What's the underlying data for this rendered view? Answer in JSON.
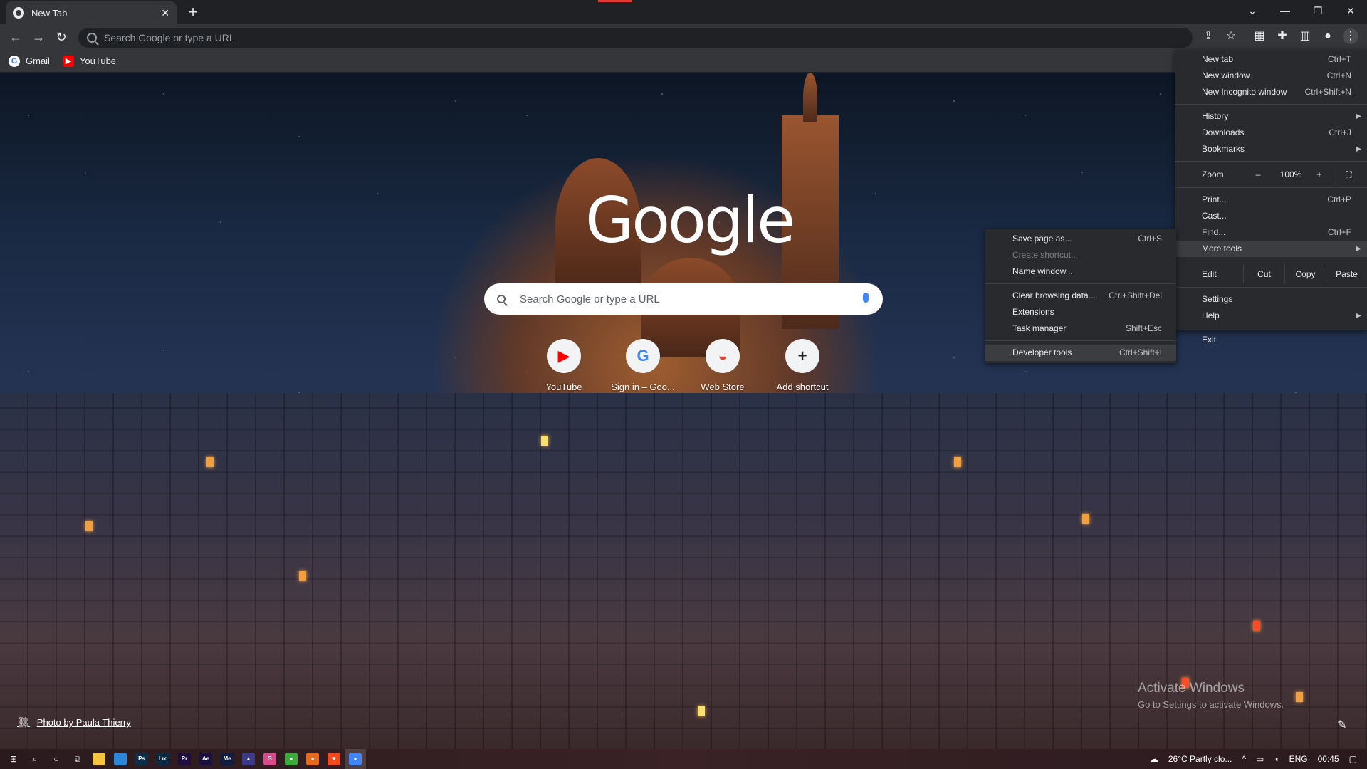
{
  "tab": {
    "title": "New Tab",
    "close": "✕",
    "new_tab": "+"
  },
  "window_controls": {
    "tab_search": "⌄",
    "minimize": "—",
    "restore": "❐",
    "close": "✕"
  },
  "toolbar": {
    "back": "←",
    "forward": "→",
    "reload": "↻",
    "omnibox_placeholder": "Search Google or type a URL",
    "icons": [
      "share-icon",
      "star-icon",
      "extension-a-icon",
      "puzzle-icon",
      "sidepanel-icon",
      "profile-icon",
      "kebab-menu-icon"
    ]
  },
  "bookmarks": [
    {
      "label": "Gmail",
      "icon": "G",
      "color": "#ffffff"
    },
    {
      "label": "YouTube",
      "icon": "▶",
      "color": "#ff0000"
    }
  ],
  "ntp": {
    "logo": "Google",
    "search_placeholder": "Search Google or type a URL",
    "shortcuts": [
      {
        "label": "YouTube",
        "icon": "▶",
        "color": "#ff0000"
      },
      {
        "label": "Sign in – Goo...",
        "icon": "G",
        "color": "#4285f4"
      },
      {
        "label": "Web Store",
        "icon": "◒",
        "color": "#ea4335"
      },
      {
        "label": "Add shortcut",
        "icon": "+",
        "color": "#202124"
      }
    ],
    "photo_credit": "Photo by Paula Thierry",
    "activate_title": "Activate Windows",
    "activate_sub": "Go to Settings to activate Windows."
  },
  "menu": {
    "new_tab": {
      "label": "New tab",
      "shortcut": "Ctrl+T"
    },
    "new_window": {
      "label": "New window",
      "shortcut": "Ctrl+N"
    },
    "new_incognito": {
      "label": "New Incognito window",
      "shortcut": "Ctrl+Shift+N"
    },
    "history": {
      "label": "History"
    },
    "downloads": {
      "label": "Downloads",
      "shortcut": "Ctrl+J"
    },
    "bookmarks": {
      "label": "Bookmarks"
    },
    "zoom": {
      "label": "Zoom",
      "minus": "–",
      "value": "100%",
      "plus": "+",
      "fullscreen": "⛶"
    },
    "print": {
      "label": "Print...",
      "shortcut": "Ctrl+P"
    },
    "cast": {
      "label": "Cast..."
    },
    "find": {
      "label": "Find...",
      "shortcut": "Ctrl+F"
    },
    "more_tools": {
      "label": "More tools"
    },
    "edit": {
      "label": "Edit",
      "cut": "Cut",
      "copy": "Copy",
      "paste": "Paste"
    },
    "settings": {
      "label": "Settings"
    },
    "help": {
      "label": "Help"
    },
    "exit": {
      "label": "Exit"
    }
  },
  "submenu": {
    "save_page": {
      "label": "Save page as...",
      "shortcut": "Ctrl+S"
    },
    "create_shortcut": {
      "label": "Create shortcut..."
    },
    "name_window": {
      "label": "Name window..."
    },
    "clear_data": {
      "label": "Clear browsing data...",
      "shortcut": "Ctrl+Shift+Del"
    },
    "extensions": {
      "label": "Extensions"
    },
    "task_manager": {
      "label": "Task manager",
      "shortcut": "Shift+Esc"
    },
    "dev_tools": {
      "label": "Developer tools",
      "shortcut": "Ctrl+Shift+I"
    }
  },
  "taskbar": {
    "apps": [
      {
        "name": "file-explorer",
        "text": "",
        "color": "#f5c542"
      },
      {
        "name": "store",
        "text": "",
        "color": "#2b88d8"
      },
      {
        "name": "photoshop",
        "text": "Ps",
        "color": "#0c2e4a"
      },
      {
        "name": "lightroom-classic",
        "text": "Lrc",
        "color": "#0a2a44"
      },
      {
        "name": "premiere",
        "text": "Pr",
        "color": "#1e0f40"
      },
      {
        "name": "after-effects",
        "text": "Ae",
        "color": "#1a1040"
      },
      {
        "name": "media-encoder",
        "text": "Me",
        "color": "#101c40"
      },
      {
        "name": "app-triangle",
        "text": "▲",
        "color": "#3b3b8a"
      },
      {
        "name": "app-s",
        "text": "S",
        "color": "#d84a8a"
      },
      {
        "name": "app-green",
        "text": "●",
        "color": "#3aaa3a"
      },
      {
        "name": "firefox",
        "text": "●",
        "color": "#e66a1e"
      },
      {
        "name": "brave",
        "text": "▼",
        "color": "#f04a1e"
      },
      {
        "name": "chrome",
        "text": "●",
        "color": "#4285f4"
      }
    ],
    "weather": "26°C  Partly clo...",
    "lang": "ENG",
    "time": "00:45"
  }
}
